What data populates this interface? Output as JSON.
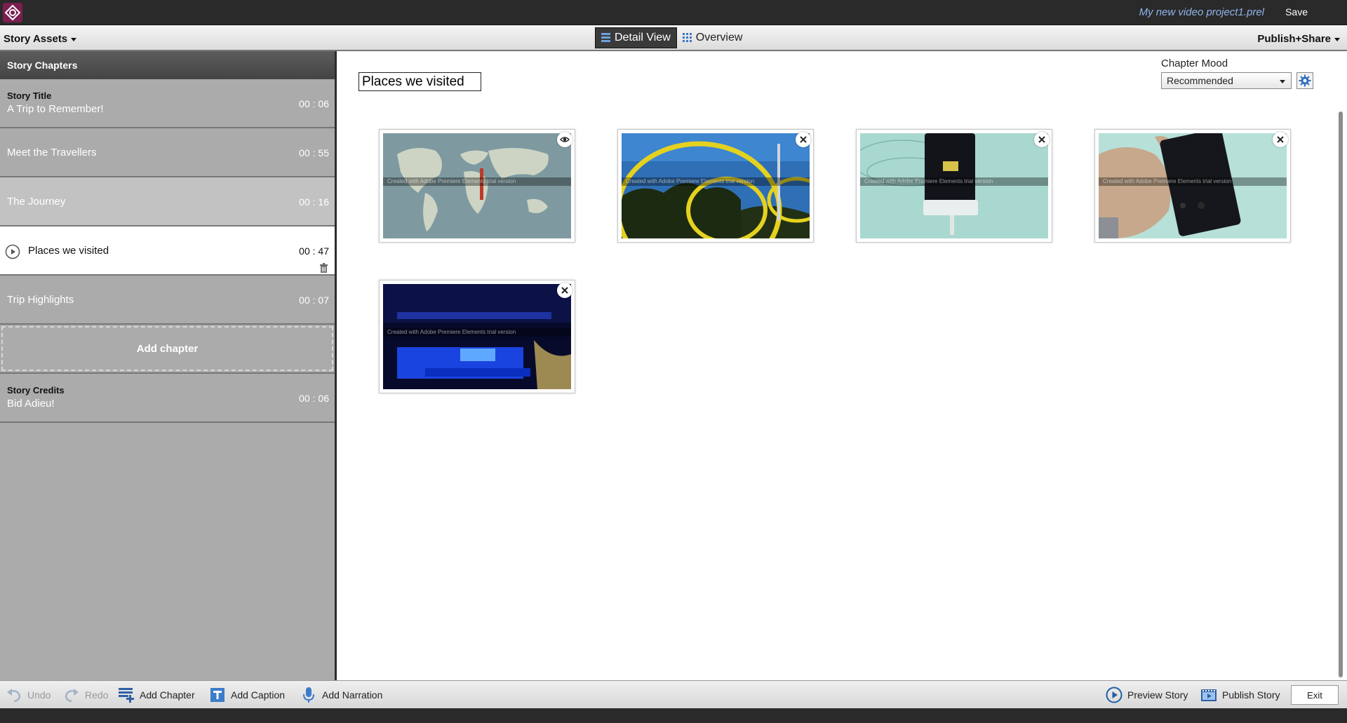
{
  "window": {
    "project_name": "My new video project1.prel",
    "save_label": "Save"
  },
  "menubar": {
    "left_menu": "Story Assets",
    "right_menu": "Publish+Share",
    "views": [
      {
        "label": "Detail View",
        "active": true
      },
      {
        "label": "Overview",
        "active": false
      }
    ]
  },
  "sidebar": {
    "header": "Story Chapters",
    "chapters": [
      {
        "subtitle": "Story Title",
        "title": "A Trip to Remember!",
        "duration": "00 : 06"
      },
      {
        "title": "Meet the Travellers",
        "duration": "00 : 55"
      },
      {
        "title": "The Journey",
        "duration": "00 : 16"
      },
      {
        "title": "Places we visited",
        "duration": "00 : 47",
        "selected": true
      },
      {
        "title": "Trip Highlights",
        "duration": "00 : 07"
      }
    ],
    "add_chapter_label": "Add chapter",
    "credits": {
      "subtitle": "Story Credits",
      "title": "Bid Adieu!",
      "duration": "00 : 06"
    }
  },
  "main": {
    "chapter_name_value": "Places we visited",
    "mood_label": "Chapter Mood",
    "mood_value": "Recommended",
    "watermark_text": "Created with  Adobe Premiere Elements  trial version",
    "thumbnails": [
      {
        "subject": "world map",
        "badge": "eye-icon"
      },
      {
        "subject": "yellow rings sculpture",
        "badge": "close-icon"
      },
      {
        "subject": "phone on charging dock",
        "badge": "close-icon"
      },
      {
        "subject": "hand holding phone",
        "badge": "close-icon"
      },
      {
        "subject": "blue lit display",
        "badge": "close-icon"
      }
    ]
  },
  "toolbar": {
    "undo_label": "Undo",
    "redo_label": "Redo",
    "add_chapter_label": "Add Chapter",
    "add_caption_label": "Add Caption",
    "add_narration_label": "Add Narration",
    "preview_label": "Preview Story",
    "publish_label": "Publish Story",
    "exit_label": "Exit"
  },
  "colors": {
    "accent_blue": "#1f5fa8",
    "title_bar": "#2a2a2a",
    "project_name": "#8fb4ea",
    "sidebar_bg": "#ababab"
  }
}
